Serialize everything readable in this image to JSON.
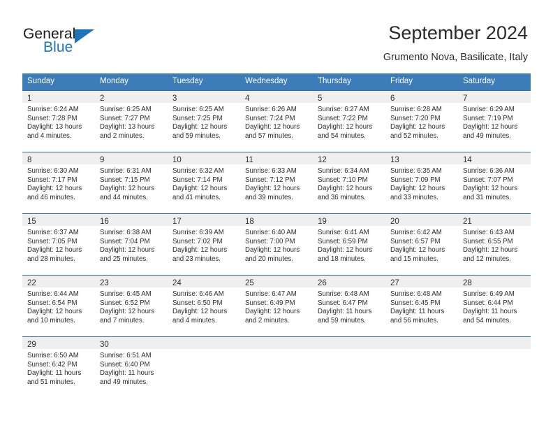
{
  "brand": {
    "name_top": "General",
    "name_bottom": "Blue",
    "accent_color": "#1d74bb"
  },
  "header": {
    "title": "September 2024",
    "location": "Grumento Nova, Basilicate, Italy"
  },
  "theme": {
    "header_bg": "#3c7cb8",
    "row_rule": "#2d6ca8",
    "daynum_strip_bg": "#efefef",
    "text": "#2b2b2b"
  },
  "weekday_headers": [
    "Sunday",
    "Monday",
    "Tuesday",
    "Wednesday",
    "Thursday",
    "Friday",
    "Saturday"
  ],
  "weeks": [
    [
      {
        "day": "1",
        "sunrise": "Sunrise: 6:24 AM",
        "sunset": "Sunset: 7:28 PM",
        "daylight_1": "Daylight: 13 hours",
        "daylight_2": "and 4 minutes."
      },
      {
        "day": "2",
        "sunrise": "Sunrise: 6:25 AM",
        "sunset": "Sunset: 7:27 PM",
        "daylight_1": "Daylight: 13 hours",
        "daylight_2": "and 2 minutes."
      },
      {
        "day": "3",
        "sunrise": "Sunrise: 6:25 AM",
        "sunset": "Sunset: 7:25 PM",
        "daylight_1": "Daylight: 12 hours",
        "daylight_2": "and 59 minutes."
      },
      {
        "day": "4",
        "sunrise": "Sunrise: 6:26 AM",
        "sunset": "Sunset: 7:24 PM",
        "daylight_1": "Daylight: 12 hours",
        "daylight_2": "and 57 minutes."
      },
      {
        "day": "5",
        "sunrise": "Sunrise: 6:27 AM",
        "sunset": "Sunset: 7:22 PM",
        "daylight_1": "Daylight: 12 hours",
        "daylight_2": "and 54 minutes."
      },
      {
        "day": "6",
        "sunrise": "Sunrise: 6:28 AM",
        "sunset": "Sunset: 7:20 PM",
        "daylight_1": "Daylight: 12 hours",
        "daylight_2": "and 52 minutes."
      },
      {
        "day": "7",
        "sunrise": "Sunrise: 6:29 AM",
        "sunset": "Sunset: 7:19 PM",
        "daylight_1": "Daylight: 12 hours",
        "daylight_2": "and 49 minutes."
      }
    ],
    [
      {
        "day": "8",
        "sunrise": "Sunrise: 6:30 AM",
        "sunset": "Sunset: 7:17 PM",
        "daylight_1": "Daylight: 12 hours",
        "daylight_2": "and 46 minutes."
      },
      {
        "day": "9",
        "sunrise": "Sunrise: 6:31 AM",
        "sunset": "Sunset: 7:15 PM",
        "daylight_1": "Daylight: 12 hours",
        "daylight_2": "and 44 minutes."
      },
      {
        "day": "10",
        "sunrise": "Sunrise: 6:32 AM",
        "sunset": "Sunset: 7:14 PM",
        "daylight_1": "Daylight: 12 hours",
        "daylight_2": "and 41 minutes."
      },
      {
        "day": "11",
        "sunrise": "Sunrise: 6:33 AM",
        "sunset": "Sunset: 7:12 PM",
        "daylight_1": "Daylight: 12 hours",
        "daylight_2": "and 39 minutes."
      },
      {
        "day": "12",
        "sunrise": "Sunrise: 6:34 AM",
        "sunset": "Sunset: 7:10 PM",
        "daylight_1": "Daylight: 12 hours",
        "daylight_2": "and 36 minutes."
      },
      {
        "day": "13",
        "sunrise": "Sunrise: 6:35 AM",
        "sunset": "Sunset: 7:09 PM",
        "daylight_1": "Daylight: 12 hours",
        "daylight_2": "and 33 minutes."
      },
      {
        "day": "14",
        "sunrise": "Sunrise: 6:36 AM",
        "sunset": "Sunset: 7:07 PM",
        "daylight_1": "Daylight: 12 hours",
        "daylight_2": "and 31 minutes."
      }
    ],
    [
      {
        "day": "15",
        "sunrise": "Sunrise: 6:37 AM",
        "sunset": "Sunset: 7:05 PM",
        "daylight_1": "Daylight: 12 hours",
        "daylight_2": "and 28 minutes."
      },
      {
        "day": "16",
        "sunrise": "Sunrise: 6:38 AM",
        "sunset": "Sunset: 7:04 PM",
        "daylight_1": "Daylight: 12 hours",
        "daylight_2": "and 25 minutes."
      },
      {
        "day": "17",
        "sunrise": "Sunrise: 6:39 AM",
        "sunset": "Sunset: 7:02 PM",
        "daylight_1": "Daylight: 12 hours",
        "daylight_2": "and 23 minutes."
      },
      {
        "day": "18",
        "sunrise": "Sunrise: 6:40 AM",
        "sunset": "Sunset: 7:00 PM",
        "daylight_1": "Daylight: 12 hours",
        "daylight_2": "and 20 minutes."
      },
      {
        "day": "19",
        "sunrise": "Sunrise: 6:41 AM",
        "sunset": "Sunset: 6:59 PM",
        "daylight_1": "Daylight: 12 hours",
        "daylight_2": "and 18 minutes."
      },
      {
        "day": "20",
        "sunrise": "Sunrise: 6:42 AM",
        "sunset": "Sunset: 6:57 PM",
        "daylight_1": "Daylight: 12 hours",
        "daylight_2": "and 15 minutes."
      },
      {
        "day": "21",
        "sunrise": "Sunrise: 6:43 AM",
        "sunset": "Sunset: 6:55 PM",
        "daylight_1": "Daylight: 12 hours",
        "daylight_2": "and 12 minutes."
      }
    ],
    [
      {
        "day": "22",
        "sunrise": "Sunrise: 6:44 AM",
        "sunset": "Sunset: 6:54 PM",
        "daylight_1": "Daylight: 12 hours",
        "daylight_2": "and 10 minutes."
      },
      {
        "day": "23",
        "sunrise": "Sunrise: 6:45 AM",
        "sunset": "Sunset: 6:52 PM",
        "daylight_1": "Daylight: 12 hours",
        "daylight_2": "and 7 minutes."
      },
      {
        "day": "24",
        "sunrise": "Sunrise: 6:46 AM",
        "sunset": "Sunset: 6:50 PM",
        "daylight_1": "Daylight: 12 hours",
        "daylight_2": "and 4 minutes."
      },
      {
        "day": "25",
        "sunrise": "Sunrise: 6:47 AM",
        "sunset": "Sunset: 6:49 PM",
        "daylight_1": "Daylight: 12 hours",
        "daylight_2": "and 2 minutes."
      },
      {
        "day": "26",
        "sunrise": "Sunrise: 6:48 AM",
        "sunset": "Sunset: 6:47 PM",
        "daylight_1": "Daylight: 11 hours",
        "daylight_2": "and 59 minutes."
      },
      {
        "day": "27",
        "sunrise": "Sunrise: 6:48 AM",
        "sunset": "Sunset: 6:45 PM",
        "daylight_1": "Daylight: 11 hours",
        "daylight_2": "and 56 minutes."
      },
      {
        "day": "28",
        "sunrise": "Sunrise: 6:49 AM",
        "sunset": "Sunset: 6:44 PM",
        "daylight_1": "Daylight: 11 hours",
        "daylight_2": "and 54 minutes."
      }
    ],
    [
      {
        "day": "29",
        "sunrise": "Sunrise: 6:50 AM",
        "sunset": "Sunset: 6:42 PM",
        "daylight_1": "Daylight: 11 hours",
        "daylight_2": "and 51 minutes."
      },
      {
        "day": "30",
        "sunrise": "Sunrise: 6:51 AM",
        "sunset": "Sunset: 6:40 PM",
        "daylight_1": "Daylight: 11 hours",
        "daylight_2": "and 49 minutes."
      },
      {
        "day": "",
        "sunrise": "",
        "sunset": "",
        "daylight_1": "",
        "daylight_2": ""
      },
      {
        "day": "",
        "sunrise": "",
        "sunset": "",
        "daylight_1": "",
        "daylight_2": ""
      },
      {
        "day": "",
        "sunrise": "",
        "sunset": "",
        "daylight_1": "",
        "daylight_2": ""
      },
      {
        "day": "",
        "sunrise": "",
        "sunset": "",
        "daylight_1": "",
        "daylight_2": ""
      },
      {
        "day": "",
        "sunrise": "",
        "sunset": "",
        "daylight_1": "",
        "daylight_2": ""
      }
    ]
  ]
}
